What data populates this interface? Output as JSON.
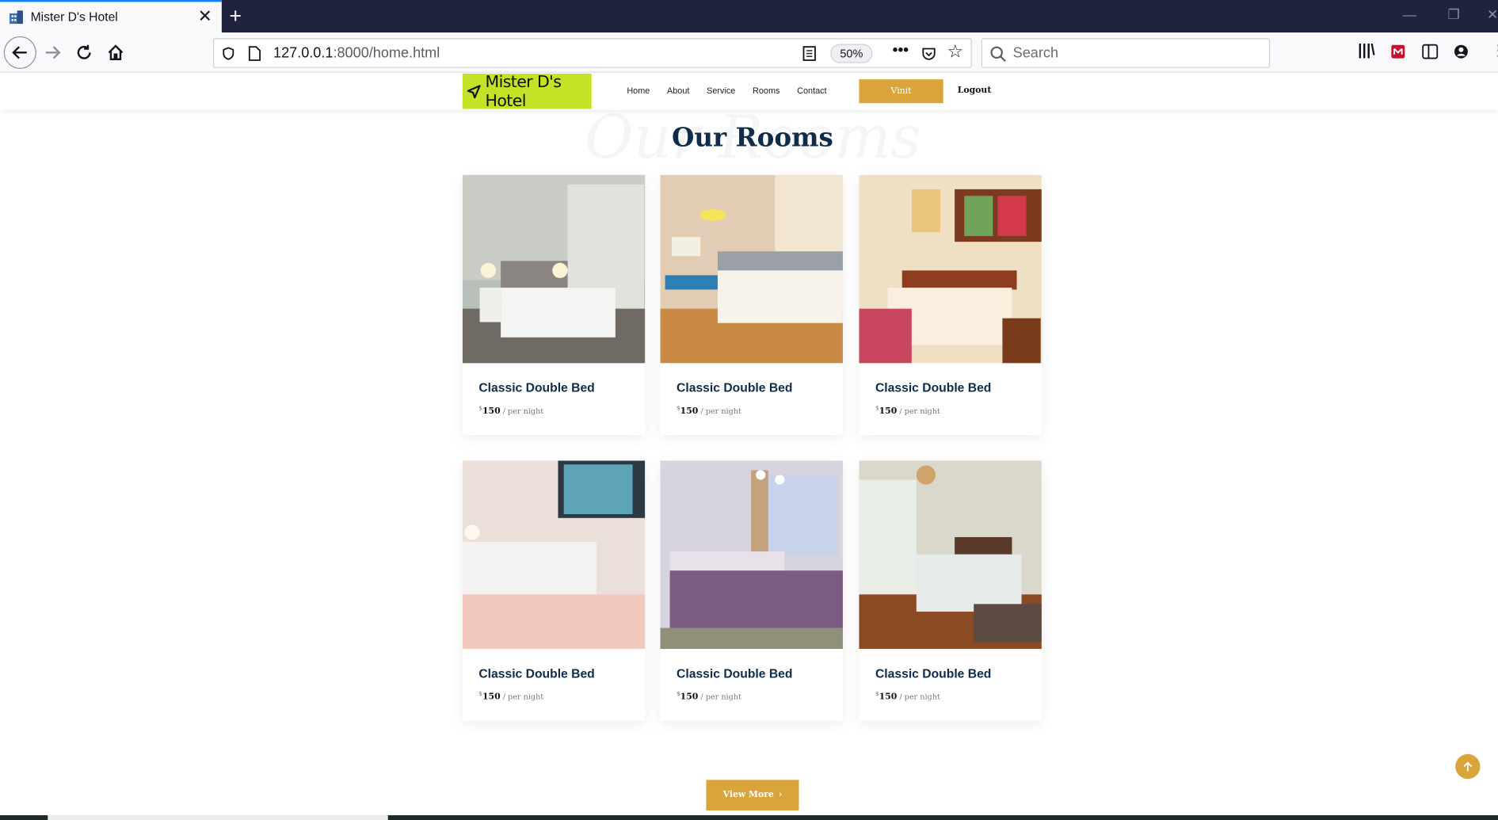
{
  "browser": {
    "tab_title": "Mister D's Hotel",
    "url_host": "127.0.0.1",
    "url_rest": ":8000/home.html",
    "zoom": "50%",
    "search_placeholder": "Search"
  },
  "site": {
    "logo_text": "Mister D's Hotel",
    "menu": [
      "Home",
      "About",
      "Service",
      "Rooms",
      "Contact"
    ],
    "visit_label": "Vinit",
    "logout_label": "Logout"
  },
  "section": {
    "bg_title": "Our Rooms",
    "title": "Our Rooms"
  },
  "rooms": [
    {
      "title": "Classic Double Bed",
      "currency": "$",
      "price": "150",
      "per": "/ per night"
    },
    {
      "title": "Classic Double Bed",
      "currency": "$",
      "price": "150",
      "per": "/ per night"
    },
    {
      "title": "Classic Double Bed",
      "currency": "$",
      "price": "150",
      "per": "/ per night"
    },
    {
      "title": "Classic Double Bed",
      "currency": "$",
      "price": "150",
      "per": "/ per night"
    },
    {
      "title": "Classic Double Bed",
      "currency": "$",
      "price": "150",
      "per": "/ per night"
    },
    {
      "title": "Classic Double Bed",
      "currency": "$",
      "price": "150",
      "per": "/ per night"
    }
  ],
  "view_more_label": "View More",
  "colors": {
    "accent": "#d9a53a",
    "logo_bg": "#c5e326",
    "heading": "#0f2c4a",
    "tabbar": "#202340"
  }
}
